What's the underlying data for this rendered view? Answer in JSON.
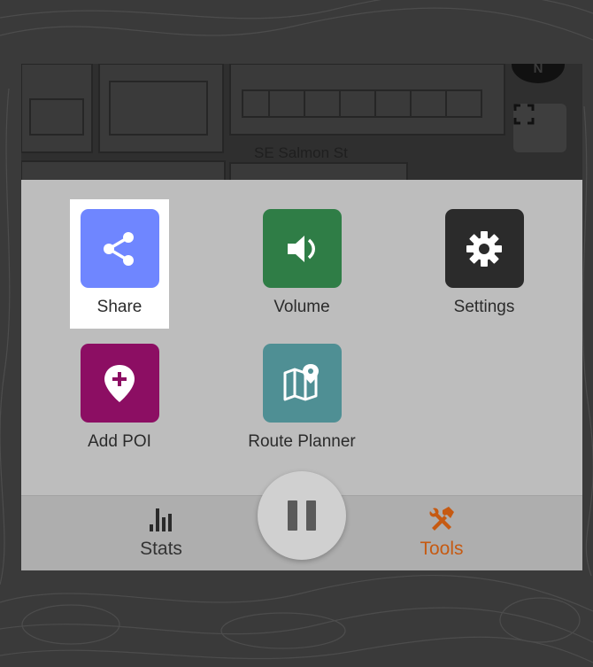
{
  "map": {
    "street_label": "SE Salmon St",
    "compass_label": "N"
  },
  "tools": [
    {
      "label": "Share",
      "icon": "share-icon",
      "color": "#6f86ff",
      "highlighted": true
    },
    {
      "label": "Volume",
      "icon": "speaker-icon",
      "color": "#2f7d46"
    },
    {
      "label": "Settings",
      "icon": "gear-icon",
      "color": "#2b2b2b"
    },
    {
      "label": "Add POI",
      "icon": "map-pin-plus-icon",
      "color": "#8c0e63"
    },
    {
      "label": "Route Planner",
      "icon": "map-route-icon",
      "color": "#4f8f94"
    }
  ],
  "bottom_nav": {
    "stats_label": "Stats",
    "tools_label": "Tools",
    "active": "Tools",
    "active_color": "#c65a12"
  },
  "pause_icon": "pause-icon"
}
